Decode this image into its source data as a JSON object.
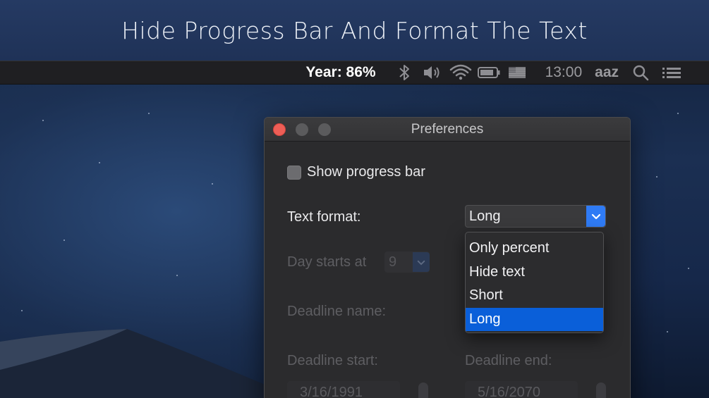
{
  "banner": {
    "title": "Hide Progress Bar And Format The Text"
  },
  "menubar": {
    "year_label": "Year: 86%",
    "time": "13:00",
    "user": "aaz",
    "icons": [
      "bluetooth-icon",
      "volume-icon",
      "wifi-icon",
      "battery-icon",
      "flag-icon",
      "search-icon",
      "list-icon"
    ]
  },
  "window": {
    "title": "Preferences",
    "show_progress_bar": {
      "label": "Show progress bar",
      "checked": false
    },
    "text_format": {
      "label": "Text format:",
      "value": "Long"
    },
    "day_starts": {
      "label": "Day starts at",
      "value": "9"
    },
    "deadline_name": {
      "label": "Deadline name:"
    },
    "deadline_start": {
      "label": "Deadline start:",
      "value": "3/16/1991"
    },
    "deadline_end": {
      "label": "Deadline end:",
      "value": "5/16/2070"
    }
  },
  "dropdown": {
    "options": [
      "Only percent",
      "Hide text",
      "Short",
      "Long"
    ],
    "selected": "Long"
  },
  "colors": {
    "accent": "#2f7bf5",
    "menu_highlight": "#0a5fd9",
    "close_button": "#ee5e56",
    "window_bg": "#2b2b2d"
  }
}
